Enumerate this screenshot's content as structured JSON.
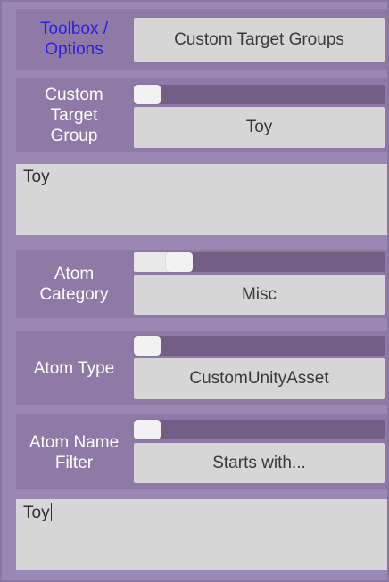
{
  "toolbox": {
    "label": "Toolbox / Options",
    "label_line1": "Toolbox /",
    "label_line2": "Options",
    "button": "Custom Target Groups"
  },
  "custom_target_group": {
    "label_line1": "Custom",
    "label_line2": "Target",
    "label_line3": "Group",
    "slider_value": 0,
    "selected": "Toy",
    "text": "Toy"
  },
  "atom_category": {
    "label_line1": "Atom",
    "label_line2": "Category",
    "slider_value": 0.18,
    "selected": "Misc"
  },
  "atom_type": {
    "label": "Atom Type",
    "slider_value": 0,
    "selected": "CustomUnityAsset"
  },
  "atom_name_filter": {
    "label_line1": "Atom Name",
    "label_line2": "Filter",
    "slider_value": 0,
    "selected": "Starts with...",
    "text": "Toy"
  },
  "colors": {
    "background": "#9b87b3",
    "panel": "#8f7aa7",
    "track": "#735f86",
    "control": "#d6d6d6",
    "link_text": "#2a1ee6"
  }
}
